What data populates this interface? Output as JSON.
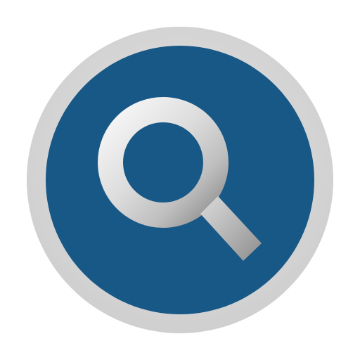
{
  "icon": {
    "name": "search-icon",
    "colors": {
      "outer_ring": "#dcdcdc",
      "outer_ring_shadow": "#c9c9c9",
      "inner_disc": "#185886",
      "magnifier_light": "#f3f3f3",
      "magnifier_mid": "#d2d2d2",
      "magnifier_dark": "#8f8f8f"
    }
  }
}
